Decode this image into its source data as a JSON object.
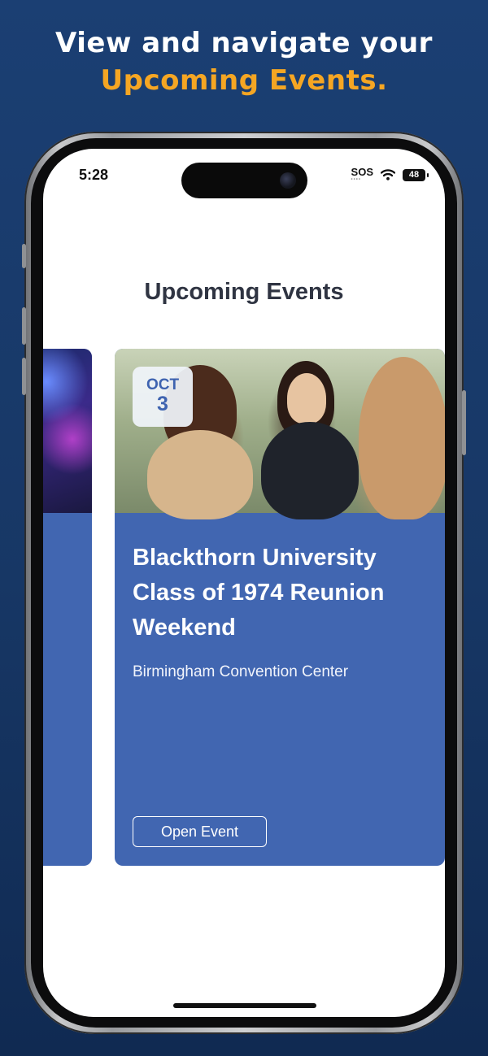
{
  "promo": {
    "line1": "View and navigate your",
    "line2": "Upcoming Events.",
    "highlight_color": "#f5a623"
  },
  "status_bar": {
    "time": "5:28",
    "sos": "SOS",
    "battery": "48",
    "icons": [
      "wifi-icon",
      "battery-icon",
      "camera-icon"
    ]
  },
  "screen": {
    "title": "Upcoming Events"
  },
  "events": [
    {
      "month": "OCT",
      "day": "3",
      "title": "Blackthorn University Class of 1974 Reunion Weekend",
      "venue": "Birmingham Convention Center",
      "button_label": "Open Event"
    }
  ],
  "colors": {
    "background": "#173765",
    "card": "#4166b1",
    "title_text": "#2f3442"
  }
}
